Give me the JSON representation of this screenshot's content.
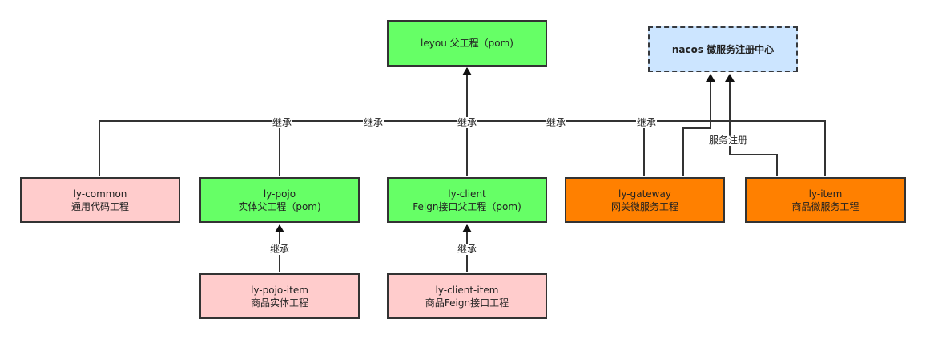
{
  "nodes": {
    "leyou": {
      "line1": "leyou  父工程（pom)"
    },
    "nacos": {
      "line1": "nacos  微服务注册中心"
    },
    "ly_common": {
      "line1": "ly-common",
      "line2": "通用代码工程"
    },
    "ly_pojo": {
      "line1": "ly-pojo",
      "line2": "实体父工程（pom)"
    },
    "ly_client": {
      "line1": "ly-client",
      "line2": "Feign接口父工程（pom)"
    },
    "ly_gateway": {
      "line1": "ly-gateway",
      "line2": "网关微服务工程"
    },
    "ly_item": {
      "line1": "ly-item",
      "line2": "商品微服务工程"
    },
    "ly_pojo_item": {
      "line1": "ly-pojo-item",
      "line2": "商品实体工程"
    },
    "ly_client_item": {
      "line1": "ly-client-item",
      "line2": "商品Feign接口工程"
    }
  },
  "edge_labels": {
    "inherit": "继承",
    "register": "服务注册"
  },
  "colors": {
    "green": "#66ff66",
    "pink": "#ffcccc",
    "orange": "#ff8000",
    "nacos_fill": "#cce5ff",
    "line": "#333333"
  }
}
